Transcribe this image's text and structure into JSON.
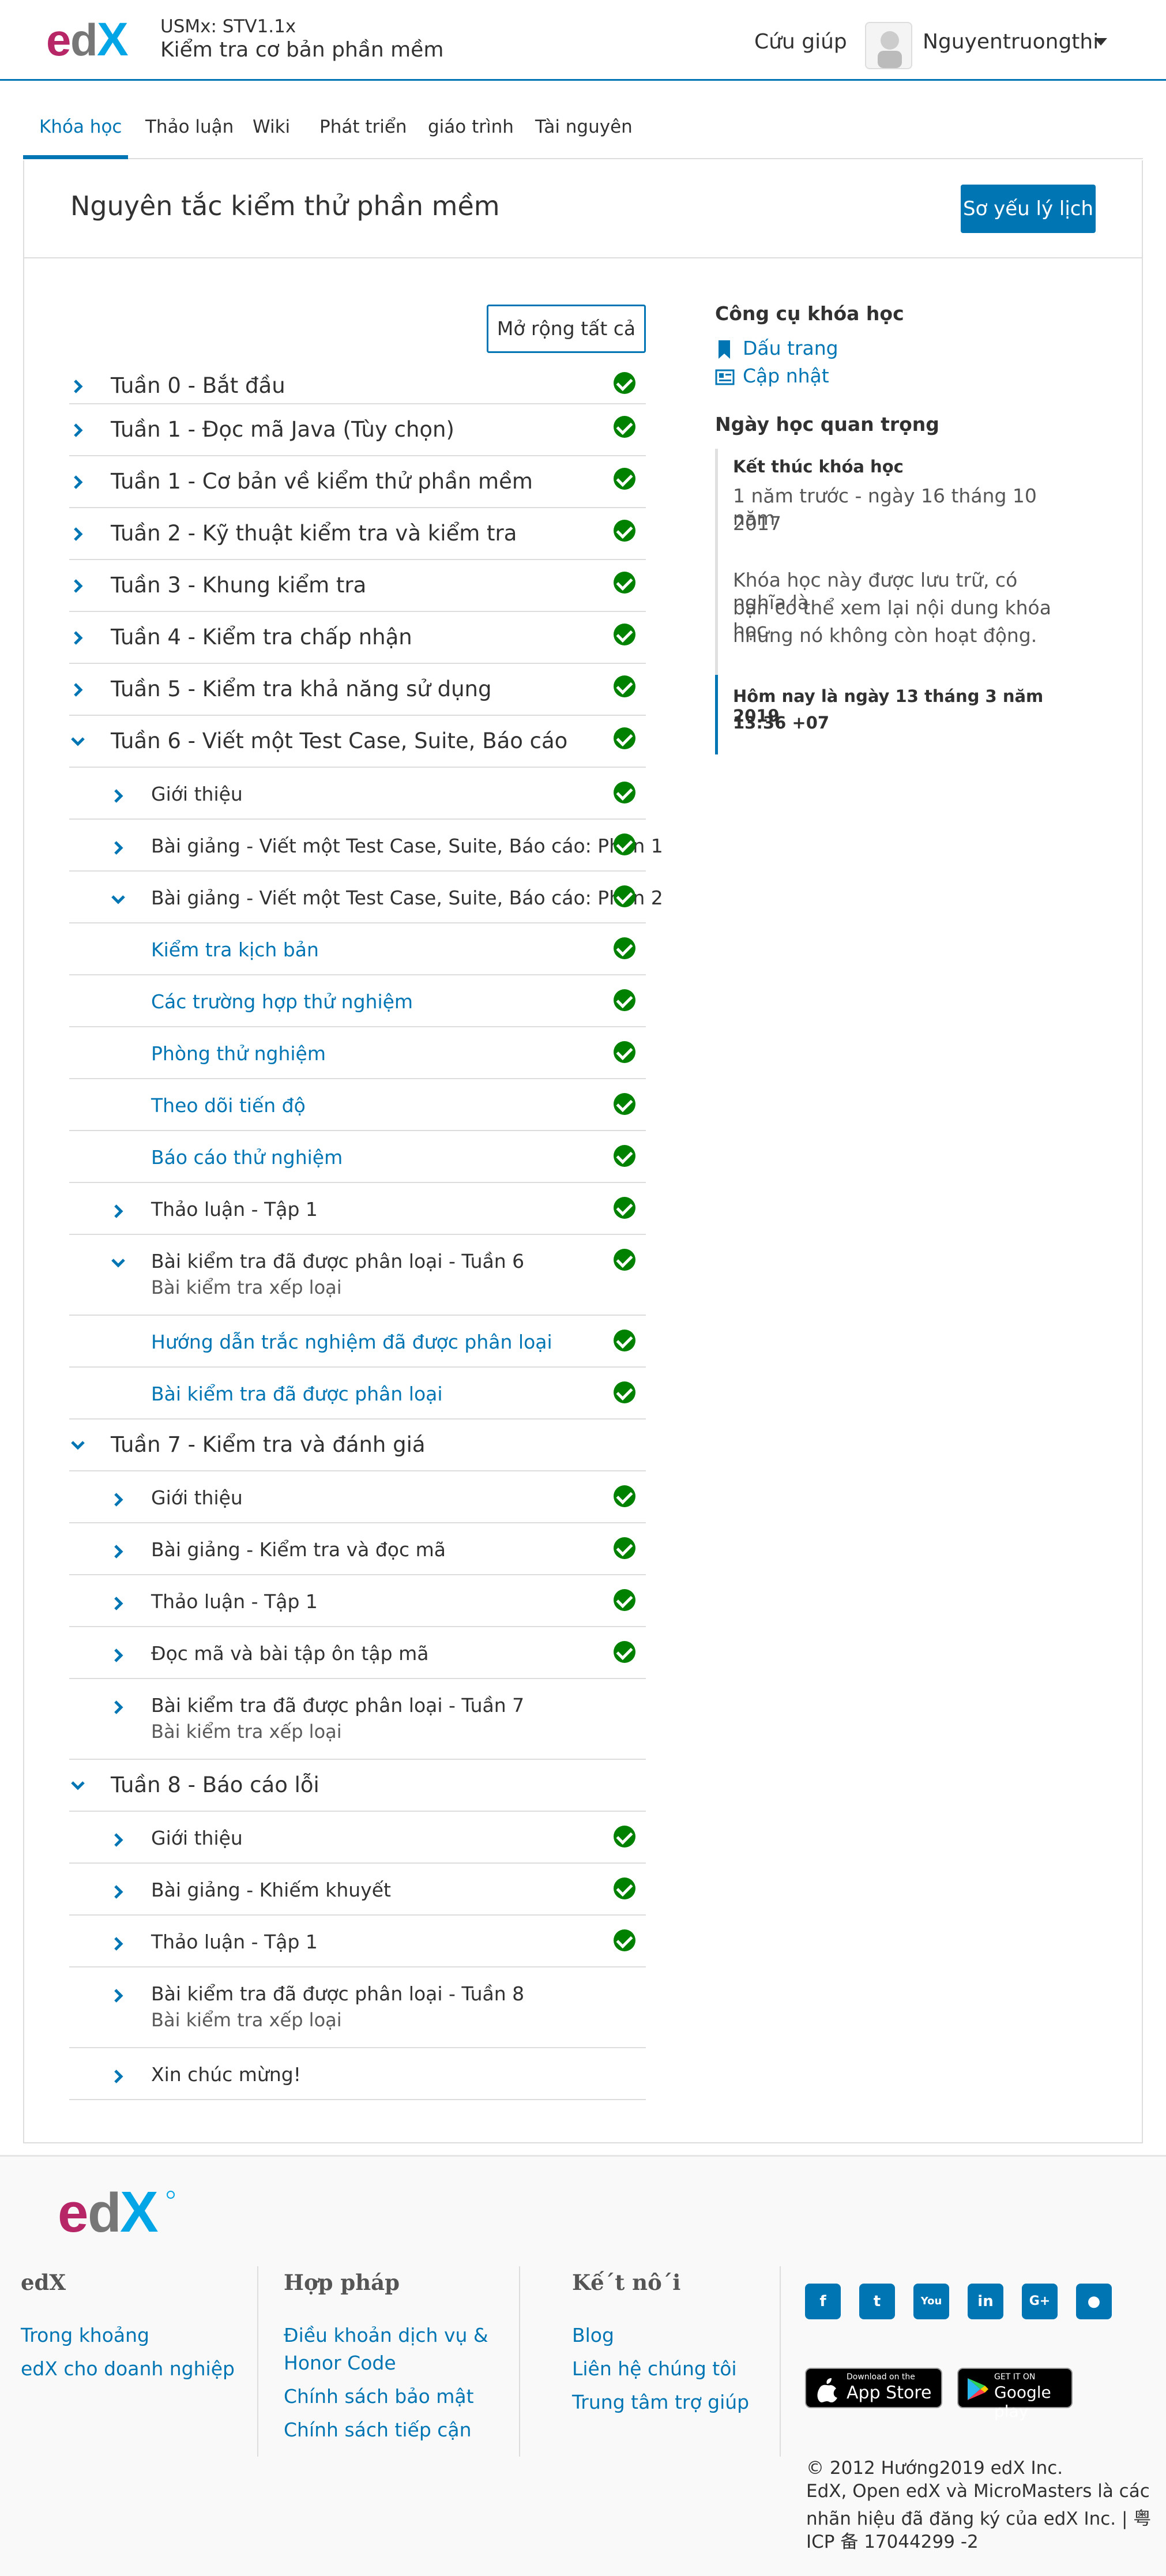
{
  "header": {
    "course_org": "USMx: STV1.1x",
    "course_name": "Kiểm tra cơ bản phần mềm",
    "help": "Cứu giúp",
    "username": "Nguyentruongthi"
  },
  "tabs": [
    "Khóa học",
    "Thảo luận",
    "Wiki",
    "Phát triển",
    "giáo trình",
    "Tài nguyên"
  ],
  "main": {
    "title": "Nguyên tắc kiểm thử phần mềm",
    "resume": "Sơ yếu lý lịch",
    "expand_all": "Mở rộng tất cả"
  },
  "outline": [
    {
      "label": "Tuần 0 - Bắt đầu",
      "sub": ""
    },
    {
      "label": "Tuần 1 - Đọc mã Java (Tùy chọn)",
      "sub": ""
    },
    {
      "label": "Tuần 1 - Cơ bản về kiểm thử phần mềm",
      "sub": ""
    },
    {
      "label": "Tuần 2 - Kỹ thuật kiểm tra và kiểm tra",
      "sub": ""
    },
    {
      "label": "Tuần 3 - Khung kiểm tra",
      "sub": ""
    },
    {
      "label": "Tuần 4 - Kiểm tra chấp nhận",
      "sub": ""
    },
    {
      "label": "Tuần 5 - Kiểm tra khả năng sử dụng",
      "sub": ""
    },
    {
      "label": "Tuần 6 - Viết một Test Case, Suite, Báo cáo",
      "sub": ""
    },
    {
      "label": "Giới thiệu",
      "sub": ""
    },
    {
      "label": "Bài giảng - Viết một Test Case, Suite, Báo cáo: Phần 1",
      "sub": ""
    },
    {
      "label": "Bài giảng - Viết một Test Case, Suite, Báo cáo: Phần 2",
      "sub": ""
    },
    {
      "label": "Kiểm tra kịch bản",
      "sub": ""
    },
    {
      "label": "Các trường hợp thử nghiệm",
      "sub": ""
    },
    {
      "label": "Phòng thử nghiệm",
      "sub": ""
    },
    {
      "label": "Theo dõi tiến độ",
      "sub": ""
    },
    {
      "label": "Báo cáo thử nghiệm",
      "sub": ""
    },
    {
      "label": "Thảo luận - Tập 1",
      "sub": ""
    },
    {
      "label": "Bài kiểm tra đã được phân loại - Tuần 6",
      "sub": "Bài kiểm tra xếp loại"
    },
    {
      "label": "Hướng dẫn trắc nghiệm đã được phân loại",
      "sub": ""
    },
    {
      "label": "Bài kiểm tra đã được phân loại",
      "sub": ""
    },
    {
      "label": "Tuần 7 - Kiểm tra và đánh giá",
      "sub": ""
    },
    {
      "label": "Giới thiệu",
      "sub": ""
    },
    {
      "label": "Bài giảng - Kiểm tra và đọc mã",
      "sub": ""
    },
    {
      "label": "Thảo luận - Tập 1",
      "sub": ""
    },
    {
      "label": "Đọc mã và bài tập ôn tập mã",
      "sub": ""
    },
    {
      "label": "Bài kiểm tra đã được phân loại - Tuần 7",
      "sub": "Bài kiểm tra xếp loại"
    },
    {
      "label": "Tuần 8 - Báo cáo lỗi",
      "sub": ""
    },
    {
      "label": "Giới thiệu",
      "sub": ""
    },
    {
      "label": "Bài giảng - Khiếm khuyết",
      "sub": ""
    },
    {
      "label": "Thảo luận - Tập 1",
      "sub": ""
    },
    {
      "label": "Bài kiểm tra đã được phân loại - Tuần 8",
      "sub": "Bài kiểm tra xếp loại"
    },
    {
      "label": "Xin chúc mừng!",
      "sub": ""
    }
  ],
  "sidebar": {
    "tools_heading": "Công cụ khóa học",
    "bookmarks": "Dấu trang",
    "updates": "Cập nhật",
    "dates_heading": "Ngày học quan trọng",
    "end_label": "Kết thúc khóa học",
    "end_line1": "1 năm trước - ngày 16 tháng 10 năm",
    "end_line2": "2017",
    "archived_1": "Khóa học này được lưu trữ, có nghĩa là",
    "archived_2": "bạn có thể xem lại nội dung khóa học",
    "archived_3": "nhưng nó không còn hoạt động.",
    "today_1": "Hôm nay là ngày 13 tháng 3 năm 2019",
    "today_2": "13:36 +07"
  },
  "footer": {
    "col1_heading": "edX",
    "col1_links": [
      "Trong khoảng",
      "edX cho doanh nghiệp"
    ],
    "col2_heading": "Hợp pháp",
    "col2_links": [
      "Điều khoản dịch vụ &",
      "Honor Code",
      "Chính sách bảo mật",
      "Chính sách tiếp cận"
    ],
    "col3_heading": "Kế´t nô´i",
    "col3_links": [
      "Blog",
      "Liên hệ chúng tôi",
      "Trung tâm trợ giúp"
    ],
    "appstore_small": "Download on the",
    "appstore_big": "App Store",
    "googleplay_small": "GET IT ON",
    "googleplay_big": "Google play",
    "copy_1": "© 2012 Hướng2019 edX Inc.",
    "copy_2": "EdX, Open edX và MicroMasters là các",
    "copy_3": "nhãn hiệu đã đăng ký của edX Inc. | 粤",
    "copy_4": "ICP 备 17044299 -2"
  }
}
